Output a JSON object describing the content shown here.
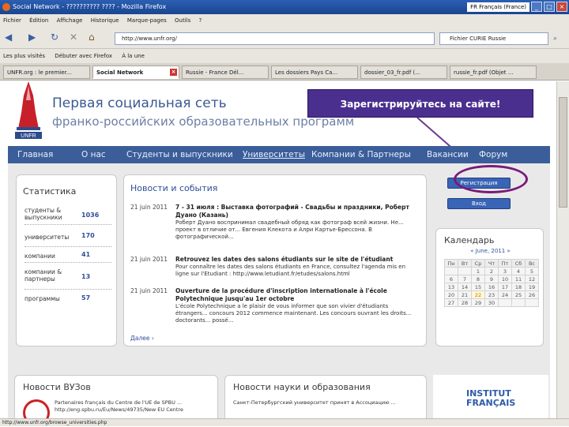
{
  "window": {
    "title": "Social Network - ?????????? ???? - Mozilla Firefox",
    "language": "FR Français (France)"
  },
  "menu": [
    "Fichier",
    "Édition",
    "Affichage",
    "Historique",
    "Marque-pages",
    "Outils",
    "?"
  ],
  "nav": {
    "url": "http://www.unfr.org/",
    "search": "Fichier CURIE Russie"
  },
  "bookmarks": [
    "Les plus visités",
    "Débuter avec Firefox",
    "À la une"
  ],
  "tabs": [
    "UNFR.org : le premier...",
    "Social Network",
    "Russie - France Dél...",
    "Les dossiers Pays Ca...",
    "dossier_03_fr.pdf (...",
    "russie_fr.pdf (Objet ..."
  ],
  "site": {
    "title": "Первая социальная сеть",
    "subtitle": "франко-российских образовательных программ",
    "logo_text": "UNFR",
    "callout": "Зарегистрируйтесь на сайте!",
    "nav": [
      "Главная",
      "О нас",
      "Студенты и выпускники",
      "Университеты",
      "Компании & Партнеры",
      "Вакансии",
      "Форум"
    ]
  },
  "stats": {
    "title": "Статистика",
    "rows": [
      {
        "label": "студенты & выпускники",
        "value": "1036"
      },
      {
        "label": "университеты",
        "value": "170"
      },
      {
        "label": "компании",
        "value": "41"
      },
      {
        "label": "компании & партнеры",
        "value": "13"
      },
      {
        "label": "программы",
        "value": "57"
      }
    ]
  },
  "news": {
    "title": "Новости и события",
    "items": [
      {
        "date": "21 juin 2011",
        "head": "7 - 31 июля : Выставка фотографий - Свадьбы и праздники, Роберт Дуано (Казань)",
        "body": "Роберт Дуано воспринимал свадебный обряд как фотограф всей жизни. Не... проект в отличие от... Евгения Клекота и Алри Картье-Брессона. В фотографической..."
      },
      {
        "date": "21 juin 2011",
        "head": "Retrouvez les dates des salons étudiants sur le site de l'étudiant",
        "body": "Pour connaître les dates des salons étudiants en France, consultez l'agenda mis en ligne sur l'Etudiant : http://www.letudiant.fr/etudes/salons.html"
      },
      {
        "date": "21 juin 2011",
        "head": "Ouverture de la procédure d'inscription internationale à l'école Polytechnique jusqu'au 1er octobre",
        "body": "L'école Polytechnique a le plaisir de vous informer que son vivier d'étudiants étrangers... concours 2012 commence maintenant. Les concours ouvrant les droits... doctorants... possé..."
      }
    ],
    "more": "Далее ›"
  },
  "auth": {
    "register": "Регистрация",
    "login": "Вход"
  },
  "calendar": {
    "title": "Календарь",
    "month": "« June, 2011 »",
    "days": [
      "Пн",
      "Вт",
      "Ср",
      "Чт",
      "Пт",
      "Сб",
      "Вс"
    ],
    "weeks": [
      [
        "",
        "",
        "1",
        "2",
        "3",
        "4",
        "5"
      ],
      [
        "6",
        "7",
        "8",
        "9",
        "10",
        "11",
        "12"
      ],
      [
        "13",
        "14",
        "15",
        "16",
        "17",
        "18",
        "19"
      ],
      [
        "20",
        "21",
        "22",
        "23",
        "24",
        "25",
        "26"
      ],
      [
        "27",
        "28",
        "29",
        "30",
        "",
        "",
        ""
      ]
    ]
  },
  "bottom": {
    "vuz_title": "Новости ВУЗов",
    "vuz_text": "Partenaires français du Centre de l'UE de SPBU ... http://eng.spbu.ru/Eu/News/49735/New EU Centre",
    "science_title": "Новости науки и образования",
    "science_text": "Санкт-Петербургский университет принят в Ассоциацию ...",
    "institut": [
      "INSTITUT",
      "FRANÇAIS"
    ]
  },
  "status": "http://www.unfr.org/browse_universities.php"
}
